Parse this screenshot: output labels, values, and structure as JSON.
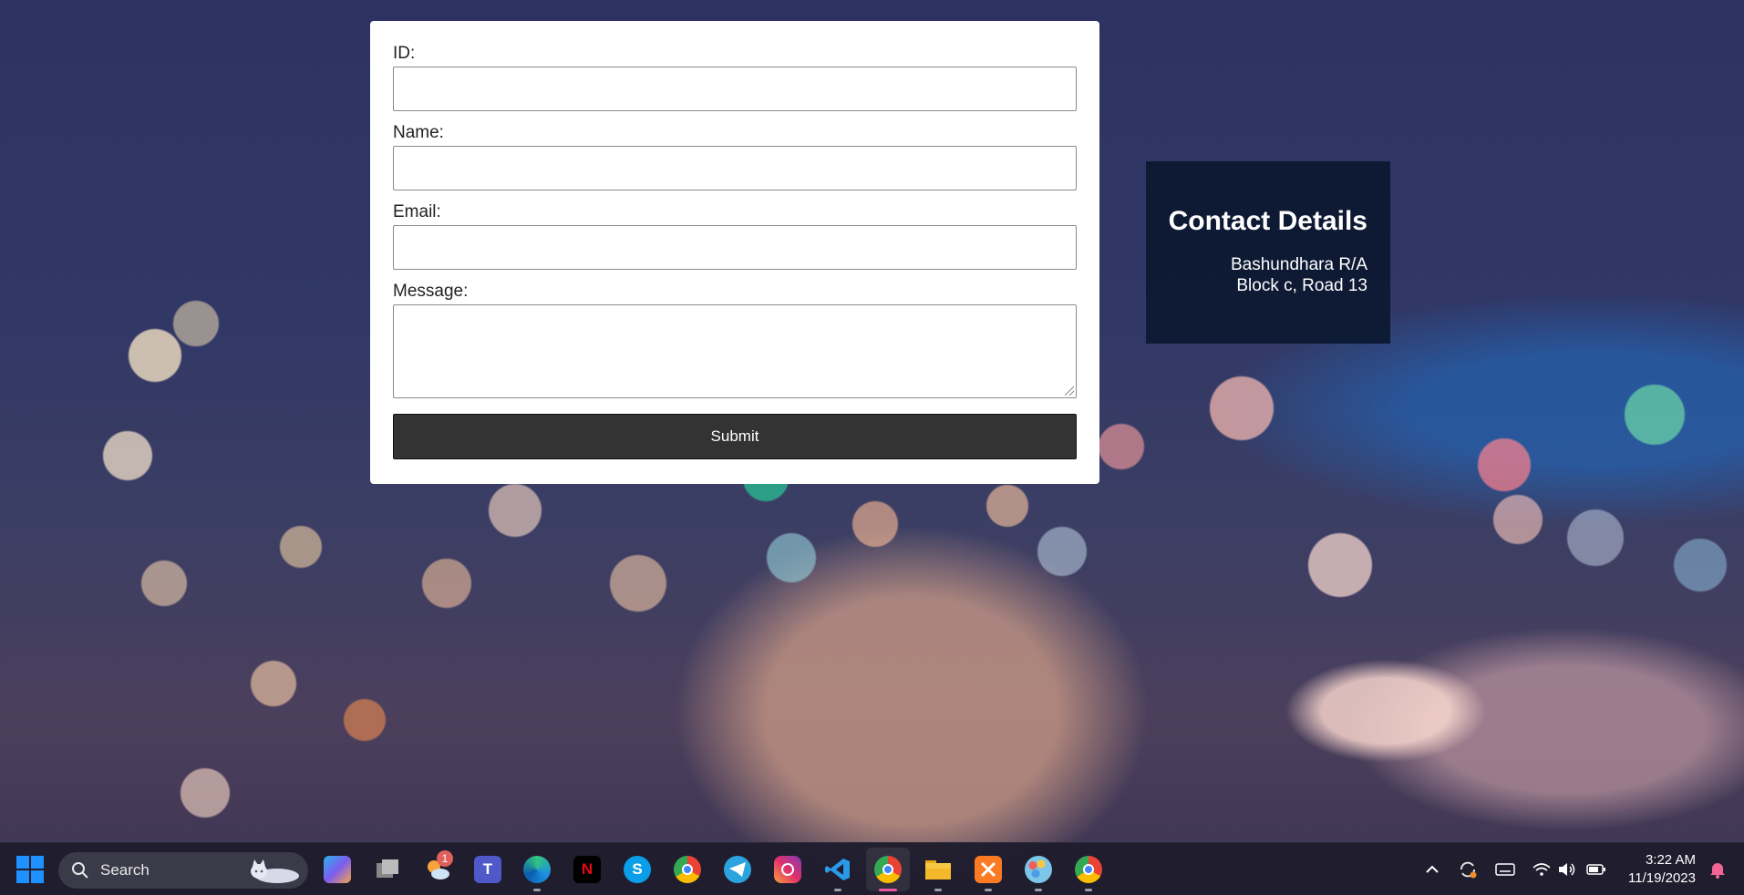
{
  "form": {
    "id_label": "ID:",
    "name_label": "Name:",
    "email_label": "Email:",
    "message_label": "Message:",
    "submit_label": "Submit"
  },
  "contact": {
    "title": "Contact Details",
    "line1": "Bashundhara R/A",
    "line2": "Block c, Road 13"
  },
  "taskbar": {
    "search_label": "Search",
    "weather_badge": "1",
    "apps": [
      "copilot-icon",
      "task-view-icon",
      "weather-icon",
      "teams-icon",
      "edge-icon",
      "netflix-icon",
      "skype-icon",
      "chrome-icon",
      "telegram-icon",
      "instagram-icon",
      "vscode-icon",
      "chrome-profile-icon",
      "file-explorer-icon",
      "xampp-icon",
      "paint-icon",
      "chrome-profile-2-icon"
    ],
    "netflix_letter": "N",
    "skype_letter": "S",
    "time": "3:22 AM",
    "date": "11/19/2023"
  },
  "colors": {
    "submit_bg": "#333333",
    "contact_bg": "#0c1830",
    "windows_blue": "#1e90ff"
  }
}
